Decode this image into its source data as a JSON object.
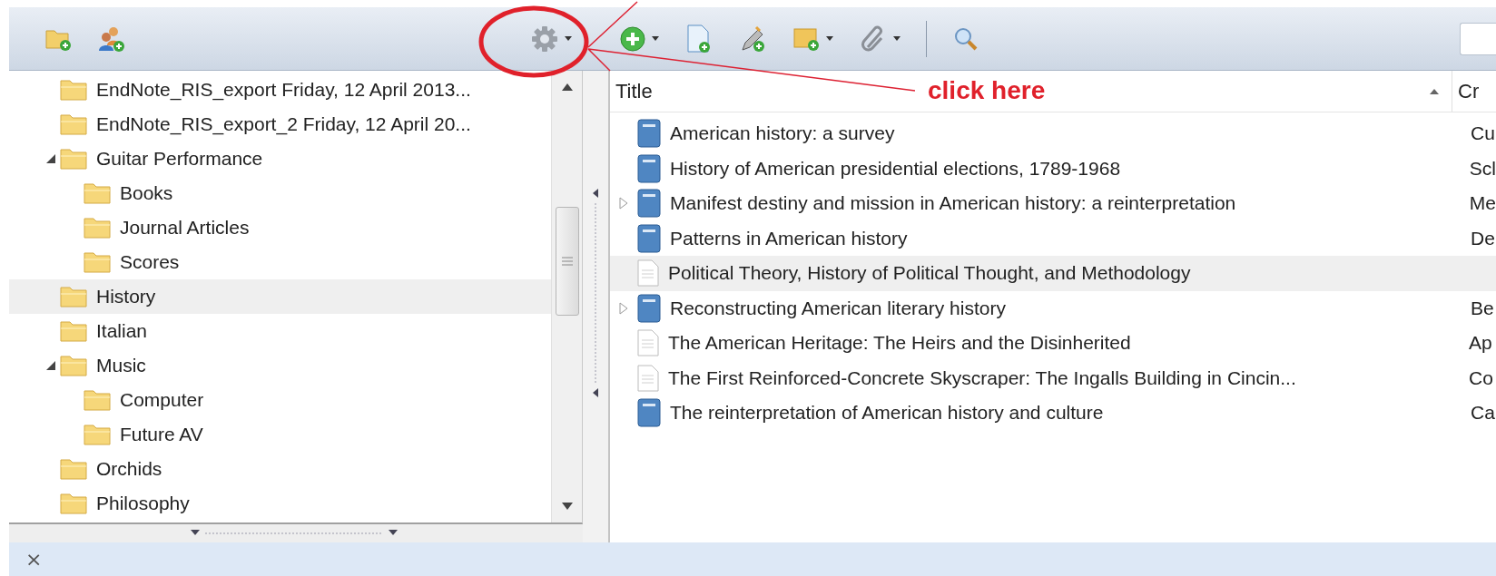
{
  "toolbar": {
    "left_buttons": [
      {
        "kind": "folder-add",
        "menu": false
      },
      {
        "kind": "people-add",
        "menu": false
      },
      {
        "kind": "gear",
        "menu": true
      }
    ],
    "right_buttons": [
      {
        "kind": "circle-add",
        "menu": true
      },
      {
        "kind": "document-add",
        "menu": false
      },
      {
        "kind": "pencil-add",
        "menu": false
      },
      {
        "kind": "box-add",
        "menu": true
      },
      {
        "kind": "paperclip",
        "menu": true
      },
      {
        "kind": "separator"
      },
      {
        "kind": "magnifier",
        "menu": false
      }
    ]
  },
  "annotation": {
    "text": "click here"
  },
  "tree": {
    "items": [
      {
        "label": "EndNote_RIS_export Friday, 12 April 2013...",
        "selected": false
      },
      {
        "label": "EndNote_RIS_export_2 Friday, 12 April 20...",
        "selected": false
      },
      {
        "label": "Guitar Performance",
        "selected": false,
        "expanded": true,
        "children": [
          {
            "label": "Books",
            "selected": false
          },
          {
            "label": "Journal Articles",
            "selected": false
          },
          {
            "label": "Scores",
            "selected": false
          }
        ]
      },
      {
        "label": "History",
        "selected": true
      },
      {
        "label": "Italian",
        "selected": false
      },
      {
        "label": "Music",
        "selected": false,
        "expanded": true,
        "children": [
          {
            "label": "Computer",
            "selected": false
          },
          {
            "label": "Future AV",
            "selected": false
          }
        ]
      },
      {
        "label": "Orchids",
        "selected": false
      },
      {
        "label": "Philosophy",
        "selected": false
      }
    ]
  },
  "table": {
    "columns": [
      {
        "label": "Title",
        "sorted": true
      },
      {
        "label": "Cr",
        "sorted": false
      }
    ],
    "rows": [
      {
        "kind": "book",
        "expandable": false,
        "selected": false,
        "title": "American history: a survey",
        "creator": "Cu"
      },
      {
        "kind": "book",
        "expandable": false,
        "selected": false,
        "title": "History of American presidential elections, 1789-1968",
        "creator": "Scl"
      },
      {
        "kind": "book",
        "expandable": true,
        "selected": false,
        "title": "Manifest destiny and mission in American history: a reinterpretation",
        "creator": "Me"
      },
      {
        "kind": "book",
        "expandable": false,
        "selected": false,
        "title": "Patterns in American history",
        "creator": "De"
      },
      {
        "kind": "document",
        "expandable": false,
        "selected": true,
        "title": "Political Theory, History of Political Thought, and Methodology"
      },
      {
        "kind": "book",
        "expandable": true,
        "selected": false,
        "title": "Reconstructing American literary history",
        "creator": "Be"
      },
      {
        "kind": "document",
        "expandable": false,
        "selected": false,
        "title": "The American Heritage: The Heirs and the Disinherited",
        "creator": "Ap"
      },
      {
        "kind": "document",
        "expandable": false,
        "selected": false,
        "title": "The First Reinforced-Concrete Skyscraper: The Ingalls Building in Cincin...",
        "creator": "Co"
      },
      {
        "kind": "book",
        "expandable": false,
        "selected": false,
        "title": "The reinterpretation of American history and culture",
        "creator": "Ca"
      }
    ]
  },
  "status_bar": {
    "close": "×"
  }
}
